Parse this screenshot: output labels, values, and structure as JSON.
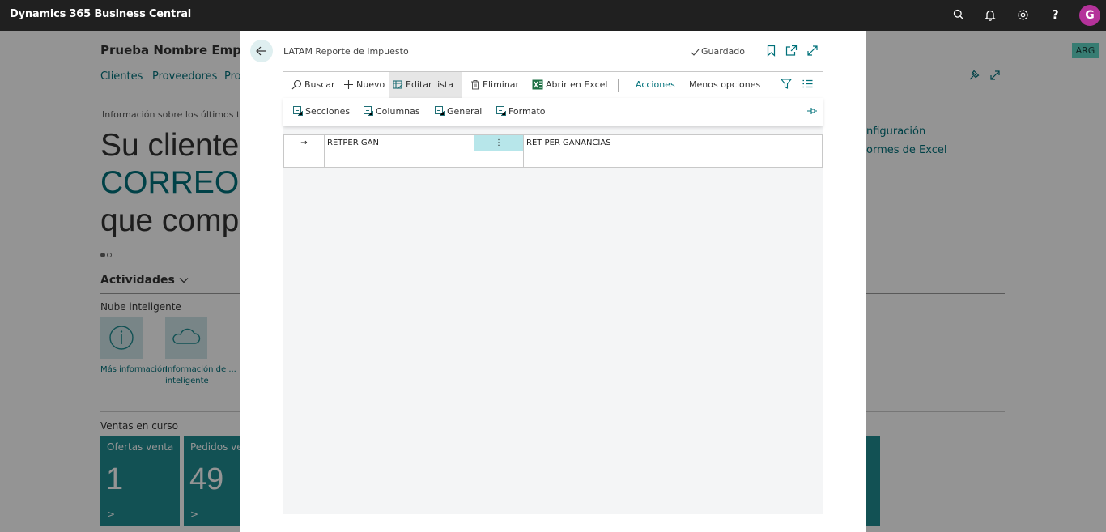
{
  "appbar": {
    "title": "Dynamics 365 Business Central",
    "help": "?",
    "avatar": "G",
    "icons": [
      "search-icon",
      "bell-icon",
      "gear-icon",
      "help-icon"
    ]
  },
  "background": {
    "company": "Prueba Nombre Empres",
    "nav": [
      "Clientes",
      "Proveedores",
      "Pro"
    ],
    "badge": "ARG",
    "info_line": "Información sobre los últimos tres",
    "hero_lines": [
      "Su cliente",
      "CORREO A",
      "que comp"
    ],
    "actividades": "Actividades",
    "nube": "Nube inteligente",
    "tiles": [
      {
        "label1": "Más información",
        "label2": ""
      },
      {
        "label1": "Información de ...",
        "label2": "inteligente"
      }
    ],
    "right_links": [
      "nfiguración",
      "ormes de Excel"
    ],
    "ventas": "Ventas en curso",
    "cues": [
      {
        "title": "Ofertas venta",
        "value": "1"
      },
      {
        "title": "Pedidos vent",
        "value": "49"
      }
    ],
    "cue_chevron": ">",
    "colors": {
      "accent": "#00717a",
      "cue": "#1f8c92",
      "badge": "#5fd6c4"
    }
  },
  "dialog": {
    "title": "LATAM Reporte de impuesto",
    "saved": "Guardado",
    "actions": {
      "buscar": "Buscar",
      "nuevo": "Nuevo",
      "editar": "Editar lista",
      "eliminar": "Eliminar",
      "excel": "Abrir en Excel",
      "acciones": "Acciones",
      "menos": "Menos opciones"
    },
    "subactions": {
      "secciones": "Secciones",
      "columnas": "Columnas",
      "general": "General",
      "formato": "Formato"
    },
    "rows": [
      {
        "marker": "→",
        "code": "RETPER GAN",
        "menu": "⋮",
        "description": "RET PER GANANCIAS"
      },
      {
        "marker": "",
        "code": "",
        "menu": "",
        "description": ""
      }
    ]
  }
}
